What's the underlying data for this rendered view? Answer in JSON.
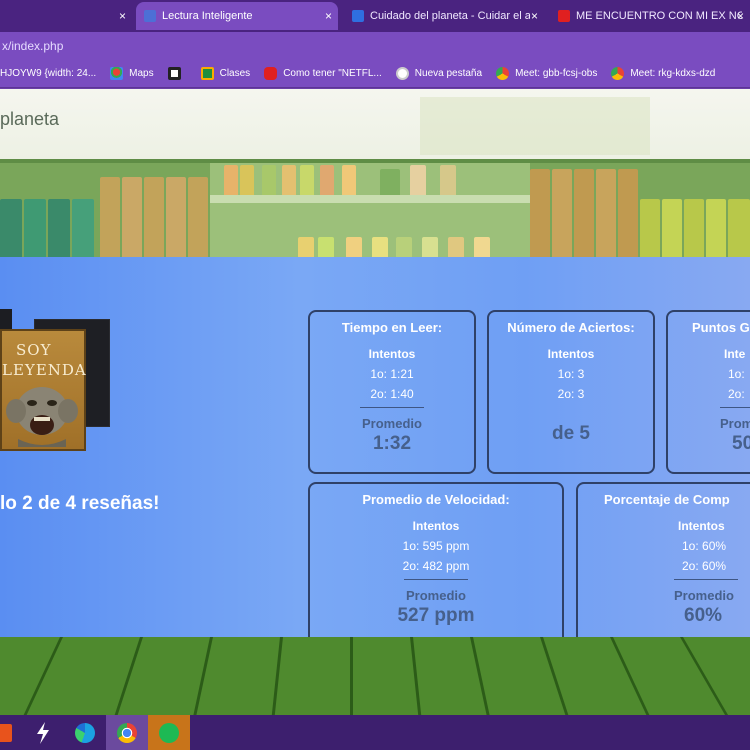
{
  "browser": {
    "tabs": [
      {
        "title": "",
        "active": false
      },
      {
        "title": "Lectura Inteligente",
        "active": true
      },
      {
        "title": "Cuidado del planeta - Cuidar el a",
        "active": false
      },
      {
        "title": "ME ENCUENTRO CON MI EX NO",
        "active": false
      }
    ],
    "close_glyph": "×",
    "url": "x/index.php",
    "bookmarks": [
      {
        "label": "HJOYW9 {width: 24...",
        "icon": "bookmark-icon"
      },
      {
        "label": "Maps",
        "icon": "maps-icon"
      },
      {
        "label": "",
        "icon": "panda-icon"
      },
      {
        "label": "Clases",
        "icon": "classroom-icon"
      },
      {
        "label": "Como tener \"NETFL...",
        "icon": "youtube-icon"
      },
      {
        "label": "Nueva pestaña",
        "icon": "globe-icon"
      },
      {
        "label": "Meet: gbb-fcsj-obs",
        "icon": "chrome-icon"
      },
      {
        "label": "Meet: rkg-kdxs-dzd",
        "icon": "chrome-icon"
      }
    ]
  },
  "page": {
    "site_title": "planeta",
    "book": {
      "cover_line1": "SOY",
      "cover_line2": "LEYENDA"
    },
    "reviews_text": "lo 2 de 4 reseñas!",
    "cards": [
      {
        "title": "Tiempo en Leer:",
        "sub": "Intentos",
        "line1": "1o: 1:21",
        "line2": "2o: 1:40",
        "avg_label": "Promedio",
        "avg_value": "1:32"
      },
      {
        "title": "Número de Aciertos:",
        "sub": "Intentos",
        "line1": "1o: 3",
        "line2": "2o: 3",
        "big": "de 5"
      },
      {
        "title": "Puntos G",
        "sub": "Inte",
        "line1": "1o:",
        "line2": "2o:",
        "avg_label": "Prom",
        "avg_value": "50"
      },
      {
        "title": "Promedio de Velocidad:",
        "sub": "Intentos",
        "line1": "1o: 595 ppm",
        "line2": "2o: 482 ppm",
        "avg_label": "Promedio",
        "avg_value": "527 ppm"
      },
      {
        "title": "Porcentaje de Comp",
        "sub": "Intentos",
        "line1": "1o: 60%",
        "line2": "2o: 60%",
        "avg_label": "Promedio",
        "avg_value": "60%"
      }
    ]
  },
  "taskbar": {
    "apps": [
      {
        "icon": "office-icon"
      },
      {
        "icon": "winamp-icon"
      },
      {
        "icon": "edge-icon"
      },
      {
        "icon": "chrome-icon",
        "active": true
      },
      {
        "icon": "spotify-icon"
      }
    ]
  },
  "colors": {
    "tabbar": "#4a2380",
    "toolbar": "#7a4cc0",
    "main_bg": "#6f9ff4",
    "card_border": "#2f4168",
    "floor": "#4f8a2e"
  }
}
